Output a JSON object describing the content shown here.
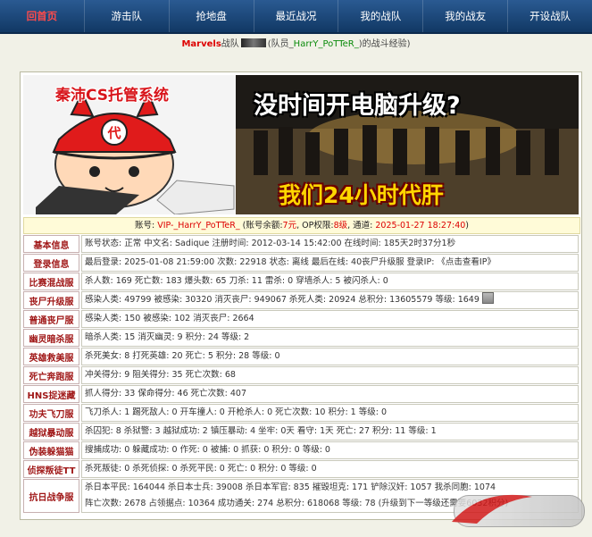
{
  "nav": {
    "items": [
      {
        "label": "回首页",
        "active": true
      },
      {
        "label": "游击队"
      },
      {
        "label": "抢地盘"
      },
      {
        "label": "最近战况"
      },
      {
        "label": "我的战队"
      },
      {
        "label": "我的战友"
      },
      {
        "label": "开设战队"
      }
    ]
  },
  "team": {
    "name": "Marvels",
    "suffix": "战队",
    "member_prefix": "(队员_",
    "player": "HarrY_PoTTeR_",
    "member_suffix": ")的战斗经验)"
  },
  "banner": {
    "brand": "秦沛CS托管系统",
    "slogan_top": "没时间开电脑升级?",
    "slogan_bottom": "我们24小时代肝"
  },
  "account": {
    "label": "账号:",
    "name": "VIP-_HarrY_PoTTeR_",
    "balance_label": "(账号余额:",
    "balance": "7元",
    "op_label": "OP权限:",
    "op": "8级",
    "channel_label": "通道:",
    "date": "2025-01-27 18:27:40",
    "close": ")"
  },
  "rows": [
    {
      "label": "基本信息",
      "lines": [
        "账号状态: 正常 中文名: Sadique 注册时间: 2012-03-14 15:42:00 在线时间: 185天2时37分1秒"
      ]
    },
    {
      "label": "登录信息",
      "lines": [
        "最后登录: 2025-01-08 21:59:00 次数: 22918 状态: 离线 最后在线: 40丧尸升级服 登录IP: 《点击查看IP》"
      ]
    },
    {
      "label": "比赛混战服",
      "lines": [
        "杀人数: 169 死亡数: 183 爆头数: 65 刀杀: 11 雷杀: 0 穿墙杀人: 5 被闪杀人: 0"
      ]
    },
    {
      "label": "丧尸升级服",
      "lines": [
        "感染人类: 49799 被感染: 30320 消灭丧尸: 949067 杀死人类: 20924 总积分: 13605579 等级: 1649"
      ]
    },
    {
      "label": "普通丧尸服",
      "lines": [
        "感染人类: 150 被感染: 102 消灭丧尸: 2664"
      ]
    },
    {
      "label": "幽灵暗杀服",
      "lines": [
        "暗杀人类: 15 消灭幽灵: 9 积分: 24 等级: 2"
      ]
    },
    {
      "label": "英雄救美服",
      "lines": [
        "杀死美女: 8 打死英雄: 20 死亡: 5 积分: 28 等级: 0"
      ]
    },
    {
      "label": "死亡奔跑服",
      "lines": [
        "冲关得分: 9 阻关得分: 35 死亡次数: 68"
      ]
    },
    {
      "label": "HNS捉迷藏",
      "lines": [
        "抓人得分: 33 保命得分: 46 死亡次数: 407"
      ]
    },
    {
      "label": "功夫飞刀服",
      "lines": [
        "飞刀杀人: 1 踢死敌人: 0 开车撞人: 0 开枪杀人: 0 死亡次数: 10 积分: 1 等级: 0"
      ]
    },
    {
      "label": "越狱暴动服",
      "lines": [
        "杀囚犯: 8 杀狱警: 3 越狱成功: 2 镇压暴动: 4 坐牢: 0天 看守: 1天 死亡: 27 积分: 11 等级: 1"
      ]
    },
    {
      "label": "伪装躲猫猫",
      "lines": [
        "搜捕成功: 0 躲藏成功: 0 作死: 0 被捕: 0 抓获: 0 积分: 0 等级: 0"
      ]
    },
    {
      "label": "侦探叛徒TT",
      "lines": [
        "杀死叛徒: 0 杀死侦探: 0 杀死平民: 0 死亡: 0 积分: 0 等级: 0"
      ]
    },
    {
      "label": "抗日战争服",
      "lines": [
        "杀日本平民: 164044 杀日本士兵: 39008 杀日本军官: 835 摧毁坦克: 171 铲除汉奸: 1057 我杀同胞: 1074",
        "阵亡次数: 2678 占领据点: 10364 成功通关: 274 总积分: 618068 等级: 78 (升级到下一等级还需要6032积分)"
      ]
    }
  ],
  "colors": {
    "nav_bg": "#1b4577",
    "label_text": "#a01818",
    "highlight_red": "#dd0000"
  },
  "icons": {
    "avatar": "player-avatar-icon",
    "watermark": "site-watermark-logo"
  }
}
